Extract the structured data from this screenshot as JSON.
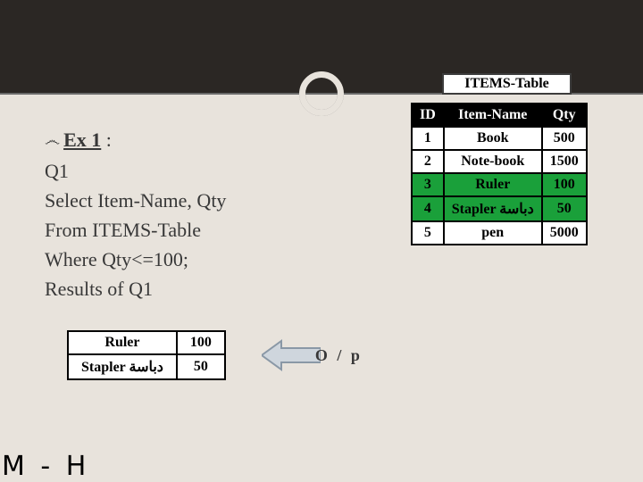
{
  "header": {
    "table_label": "ITEMS-Table"
  },
  "content": {
    "ex_label": "Ex 1",
    "ex_colon": " :",
    "line_q1": "Q1",
    "line_select": "Select Item-Name, Qty",
    "line_from": "From ITEMS-Table",
    "line_where": "Where Qty<=100;",
    "line_results": "Results of Q1"
  },
  "items_table": {
    "headers": {
      "id": "ID",
      "name": "Item-Name",
      "qty": "Qty"
    },
    "rows": [
      {
        "id": "1",
        "name": "Book",
        "qty": "500"
      },
      {
        "id": "2",
        "name": "Note-book",
        "qty": "1500"
      },
      {
        "id": "3",
        "name": "Ruler",
        "qty": "100"
      },
      {
        "id": "4",
        "name": "Stapler دباسة",
        "qty": "50"
      },
      {
        "id": "5",
        "name": "pen",
        "qty": "5000"
      }
    ]
  },
  "result_table": {
    "rows": [
      {
        "name": "Ruler",
        "qty": "100"
      },
      {
        "name": "Stapler دباسة",
        "qty": "50"
      }
    ]
  },
  "op_label": "O / p",
  "footer": "M - H"
}
